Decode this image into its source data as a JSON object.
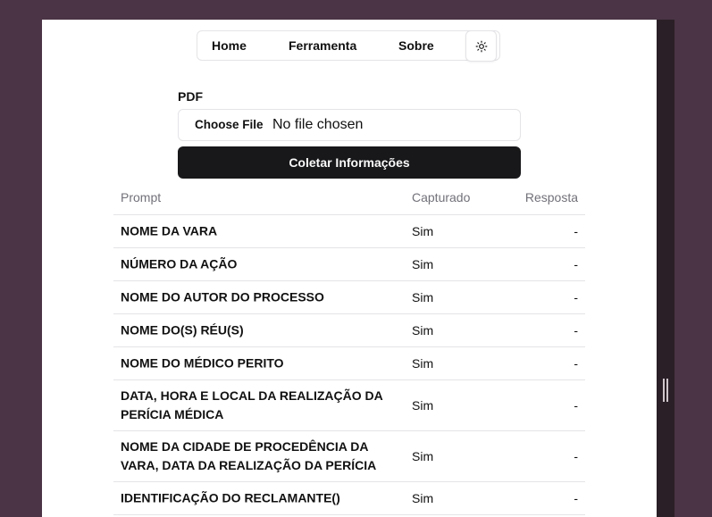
{
  "nav": {
    "home": "Home",
    "tool": "Ferramenta",
    "about": "Sobre",
    "theme_icon": "sun-icon"
  },
  "form": {
    "pdf_label": "PDF",
    "file_button": "Choose File",
    "file_status": "No file chosen",
    "submit": "Coletar Informações"
  },
  "table": {
    "headers": [
      "Prompt",
      "Capturado",
      "Resposta"
    ],
    "rows": [
      {
        "prompt": "NOME DA VARA",
        "captured": "Sim",
        "response": "-"
      },
      {
        "prompt": "NÚMERO DA AÇÃO",
        "captured": "Sim",
        "response": "-"
      },
      {
        "prompt": "NOME DO AUTOR DO PROCESSO",
        "captured": "Sim",
        "response": "-"
      },
      {
        "prompt": "NOME DO(S) RÉU(S)",
        "captured": "Sim",
        "response": "-"
      },
      {
        "prompt": "NOME DO MÉDICO PERITO",
        "captured": "Sim",
        "response": "-"
      },
      {
        "prompt": "DATA, HORA E LOCAL DA REALIZAÇÃO DA PERÍCIA MÉDICA",
        "captured": "Sim",
        "response": "-"
      },
      {
        "prompt": "NOME DA CIDADE DE PROCEDÊNCIA DA VARA, DATA DA REALIZAÇÃO DA PERÍCIA",
        "captured": "Sim",
        "response": "-"
      },
      {
        "prompt": "IDENTIFICAÇÃO DO RECLAMANTE()",
        "captured": "Sim",
        "response": "-"
      }
    ]
  },
  "colors": {
    "background": "#4a3445",
    "button_dark": "#18181b",
    "border": "#e4e4e7",
    "muted_text": "#71717a"
  }
}
